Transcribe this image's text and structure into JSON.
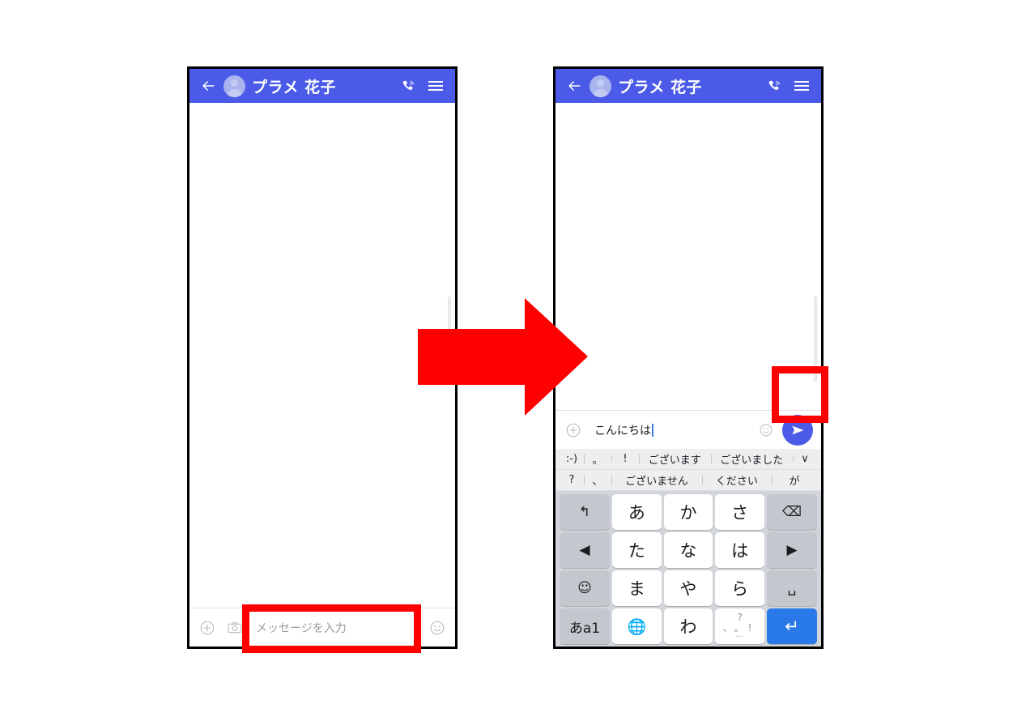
{
  "meta": {
    "accent_blue": "#4b5be8",
    "enter_blue": "#2979e8",
    "annotation_red": "#ff0000"
  },
  "before_phone": {
    "header": {
      "back_icon": "back-arrow-icon",
      "avatar_icon": "contact-avatar",
      "title": "プラメ 花子",
      "call_icon": "call-icon",
      "menu_icon": "hamburger-menu-icon"
    },
    "input_bar": {
      "plus_icon": "plus-circle-icon",
      "camera_icon": "camera-icon",
      "placeholder": "メッセージを入力",
      "value": "",
      "emoji_icon": "smiley-icon"
    }
  },
  "after_phone": {
    "header": {
      "back_icon": "back-arrow-icon",
      "avatar_icon": "contact-avatar",
      "title": "プラメ 花子",
      "call_icon": "call-icon",
      "menu_icon": "hamburger-menu-icon"
    },
    "input_bar": {
      "plus_icon": "plus-circle-icon",
      "placeholder": "メッセージを入力",
      "value": "こんにちは",
      "emoji_icon": "smiley-icon",
      "send_icon": "send-paper-plane-icon",
      "send_label": "送信"
    },
    "keyboard": {
      "suggestion_row_1": [
        ":-)",
        "。",
        "!",
        "ございます",
        "ございました",
        "∨"
      ],
      "suggestion_row_2": [
        "?",
        "、",
        "ございません",
        "ください",
        "が"
      ],
      "keys": [
        {
          "label": "↰",
          "name": "key-undo",
          "type": "fn"
        },
        {
          "label": "あ",
          "name": "key-a",
          "type": "char"
        },
        {
          "label": "か",
          "name": "key-ka",
          "type": "char"
        },
        {
          "label": "さ",
          "name": "key-sa",
          "type": "char"
        },
        {
          "label": "⌫",
          "name": "key-backspace",
          "type": "fn"
        },
        {
          "label": "◀",
          "name": "key-cursor-left",
          "type": "fn"
        },
        {
          "label": "た",
          "name": "key-ta",
          "type": "char"
        },
        {
          "label": "な",
          "name": "key-na",
          "type": "char"
        },
        {
          "label": "は",
          "name": "key-ha",
          "type": "char"
        },
        {
          "label": "▶",
          "name": "key-cursor-right",
          "type": "fn"
        },
        {
          "label": "☺",
          "name": "key-emoji",
          "type": "fn"
        },
        {
          "label": "ま",
          "name": "key-ma",
          "type": "char"
        },
        {
          "label": "や",
          "name": "key-ya",
          "type": "char"
        },
        {
          "label": "ら",
          "name": "key-ra",
          "type": "char"
        },
        {
          "label": "␣",
          "name": "key-space",
          "type": "fn"
        },
        {
          "label": "あa1",
          "name": "key-input-mode",
          "type": "fn-ime"
        },
        {
          "label": "🌐",
          "name": "key-globe",
          "type": "char-globe"
        },
        {
          "label": "わ",
          "name": "key-wa",
          "type": "char"
        },
        {
          "label": "、。?!…",
          "name": "key-punctuation",
          "type": "char-punct"
        },
        {
          "label": "↵",
          "name": "key-enter",
          "type": "enter"
        }
      ]
    }
  },
  "annotations": {
    "arrow_name": "transition-arrow",
    "highlight_input_name": "highlight-message-input",
    "highlight_send_name": "highlight-send-button"
  }
}
